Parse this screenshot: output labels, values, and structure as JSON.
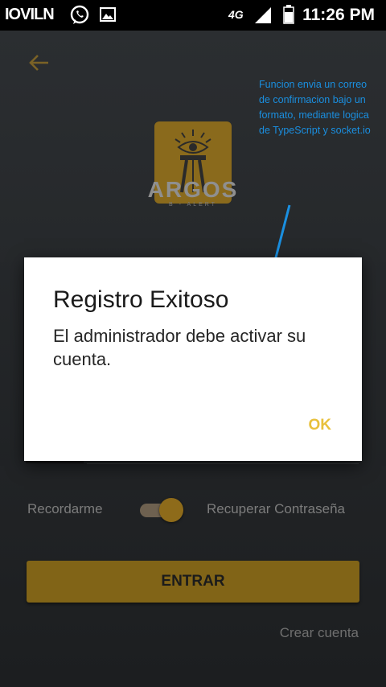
{
  "status_bar": {
    "carrier": "IOVILN",
    "network": "4G",
    "time": "11:26 PM"
  },
  "brand": {
    "name": "ARGOS",
    "subtitle": "B - ALERT"
  },
  "annotation": {
    "text": "Funcion envia un correo de confirmacion bajo un formato, mediante logica de TypeScript y socket.io"
  },
  "login": {
    "password_mask": "•••••",
    "remember_label": "Recordarme",
    "recover_label": "Recuperar Contraseña",
    "enter_label": "ENTRAR",
    "create_label": "Crear cuenta"
  },
  "dialog": {
    "title": "Registro Exitoso",
    "message": "El administrador debe activar su cuenta.",
    "ok_label": "OK"
  },
  "colors": {
    "accent": "#8a6a1c",
    "ok_text": "#e8c03b",
    "annotation": "#1a8fe0"
  }
}
